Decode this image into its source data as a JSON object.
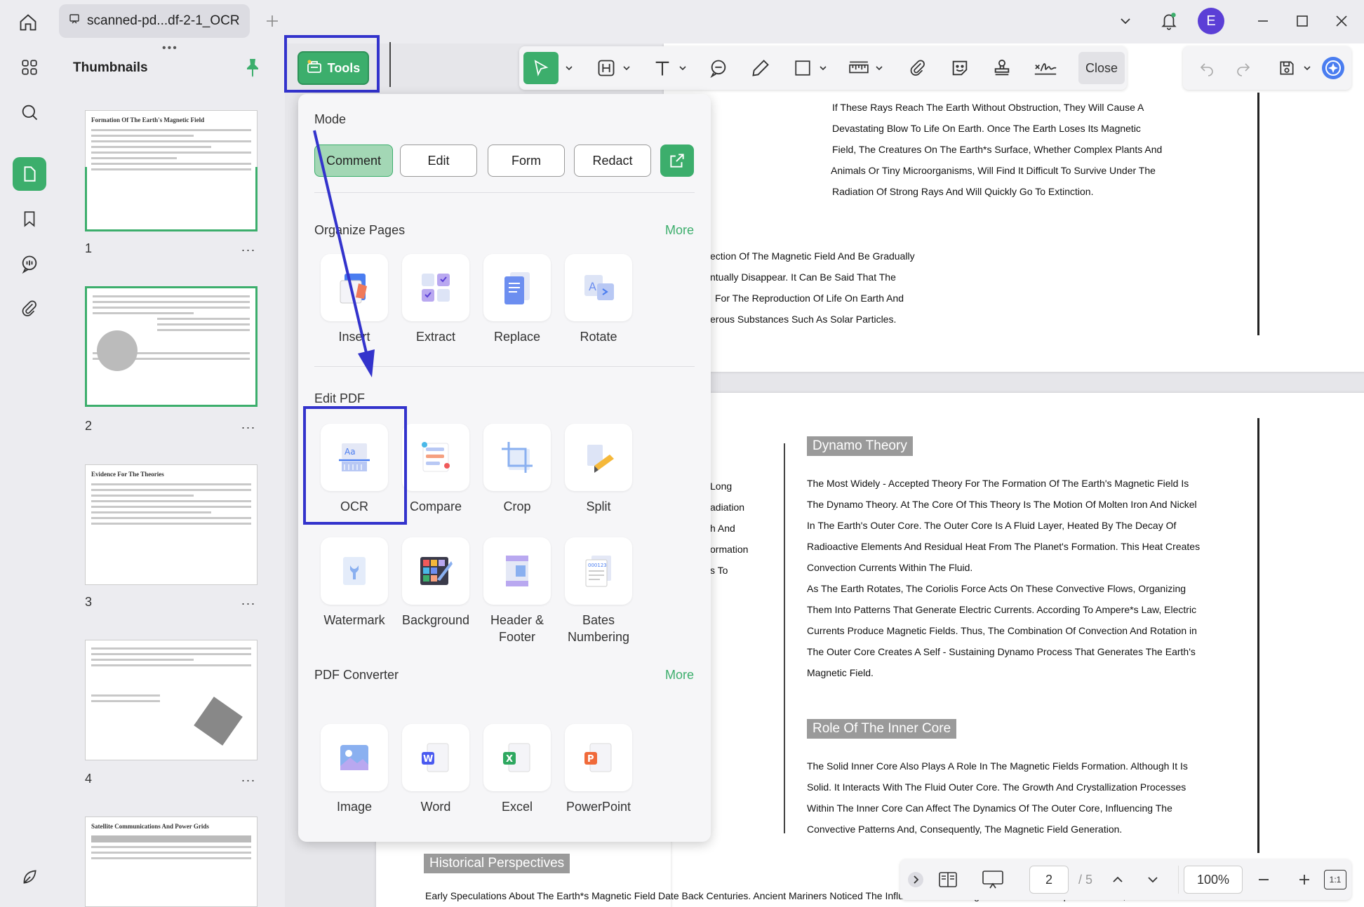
{
  "titlebar": {
    "doc_tab": "scanned-pd...df-2-1_OCR",
    "avatar_letter": "E"
  },
  "thumbnails": {
    "title": "Thumbnails",
    "pages": [
      {
        "num": "1",
        "title": "Formation Of The Earth's Magnetic Field"
      },
      {
        "num": "2",
        "title": ""
      },
      {
        "num": "3",
        "title": "Evidence For The Theories"
      },
      {
        "num": "4",
        "title": ""
      },
      {
        "num": "",
        "title": "Satellite Communications And Power Grids"
      }
    ],
    "more": "..."
  },
  "toolbar": {
    "tools_label": "Tools",
    "close_label": "Close"
  },
  "tools_panel": {
    "mode_label": "Mode",
    "modes": [
      "Comment",
      "Edit",
      "Form",
      "Redact"
    ],
    "organize_label": "Organize Pages",
    "organize_more": "More",
    "organize": [
      "Insert",
      "Extract",
      "Replace",
      "Rotate"
    ],
    "edit_label": "Edit PDF",
    "edit_row1": [
      "OCR",
      "Compare",
      "Crop",
      "Split"
    ],
    "edit_row2": [
      "Watermark",
      "Background",
      "Header & Footer",
      "Bates Numbering"
    ],
    "converter_label": "PDF Converter",
    "converter_more": "More",
    "converter": [
      "Image",
      "Word",
      "Excel",
      "PowerPoint"
    ]
  },
  "document": {
    "page1_lines": [
      "If These Rays Reach The Earth Without Obstruction, They Will Cause A",
      "Devastating Blow To Life On Earth. Once The Earth Loses Its Magnetic",
      "Field, The Creatures On The Earth*s Surface, Whether Complex Plants And",
      "Animals Or Tiny Microorganisms, Will Find It Difficult To Survive Under The",
      "Radiation Of Strong Rays And Will Quickly Go To Extinction."
    ],
    "page1_left_lines": [
      "ection Of The Magnetic Field And Be Gradually",
      "ntually Disappear. It Can Be Said That The",
      "For The Reproduction Of Life On Earth And",
      "erous Substances Such As Solar Particles."
    ],
    "page2_left_frag": [
      "Long",
      "adiation",
      "h And",
      "ormation",
      "s To"
    ],
    "dynamo_heading": "Dynamo Theory",
    "dynamo_lines": [
      "The Most Widely - Accepted Theory For The Formation Of The Earth's Magnetic Field Is",
      "The Dynamo Theory. At The Core Of This Theory Is The Motion Of Molten Iron And Nickel",
      "In The Earth's Outer Core. The Outer Core Is A Fluid Layer, Heated By The Decay Of",
      "Radioactive Elements And Residual Heat From The Planet's Formation. This Heat Creates",
      "Convection Currents Within The Fluid.",
      "As The Earth Rotates, The Coriolis Force Acts On These Convective Flows, Organizing",
      "Them Into Patterns That Generate Electric Currents. According To Ampere*s Law, Electric",
      "Currents Produce Magnetic Fields. Thus, The Combination Of Convection And Rotation in",
      "The Outer Core Creates A Self - Sustaining Dynamo Process That Generates The Earth's",
      "Magnetic Field."
    ],
    "inner_heading": "Role Of The Inner Core",
    "inner_lines": [
      "The Solid Inner Core Also Plays A Role In The Magnetic Fields Formation. Although It Is",
      "Solid. It Interacts With The Fluid Outer Core. The Growth And Crystallization Processes",
      "Within The Inner Core Can Affect The Dynamics Of The Outer Core, Influencing The",
      "Convective Patterns And, Consequently, The Magnetic Field Generation."
    ],
    "historical_heading": "Historical Perspectives",
    "historical_line": "Early Speculations About The Earth*s Magnetic Field Date Back Centuries. Ancient Mariners Noticed The Influence Of The Magnetic Field On Compass Needles, But It"
  },
  "bottom_bar": {
    "page_current": "2",
    "page_total": "/ 5",
    "zoom": "100%",
    "fit_label": "1:1"
  },
  "colors": {
    "accent": "#3cae6c",
    "highlight": "#3333cc"
  }
}
